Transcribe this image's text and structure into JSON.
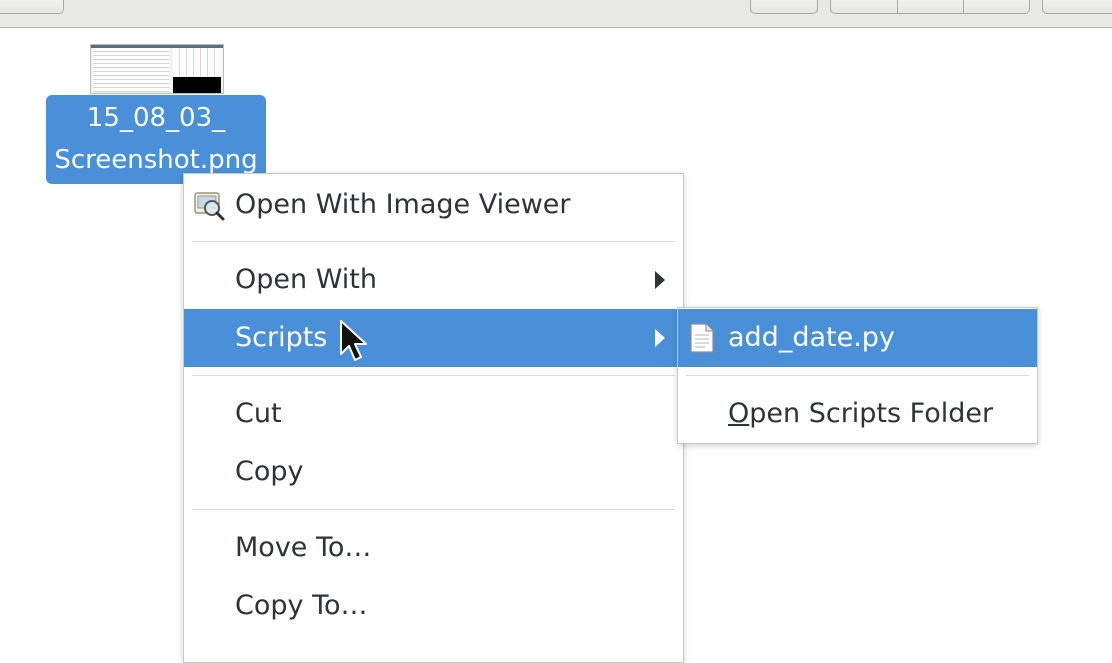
{
  "file": {
    "name_line1": "15_08_03_",
    "name_line2": "Screenshot.png"
  },
  "context_menu": {
    "items": [
      {
        "label": "Open With Image Viewer",
        "icon": "image-viewer-icon"
      },
      {
        "label": "Open With",
        "has_submenu": true
      },
      {
        "label": "Scripts",
        "has_submenu": true,
        "highlighted": true
      },
      {
        "label": "Cut"
      },
      {
        "label": "Copy"
      },
      {
        "label": "Move To…"
      },
      {
        "label": "Copy To…"
      }
    ]
  },
  "scripts_submenu": {
    "items": [
      {
        "label": "add_date.py",
        "icon": "script-file-icon",
        "highlighted": true
      },
      {
        "label_mnemonic": "O",
        "label_rest": "pen Scripts Folder"
      }
    ]
  },
  "colors": {
    "selection": "#4a90d9",
    "menu_text": "#2e3436"
  }
}
